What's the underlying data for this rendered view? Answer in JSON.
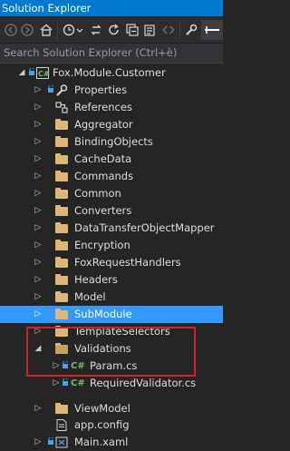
{
  "window": {
    "title": "Solution Explorer"
  },
  "search": {
    "placeholder": "Search Solution Explorer (Ctrl+è)"
  },
  "toolbar": {
    "buttons": [
      "back-icon",
      "forward-icon",
      "home-icon",
      "history-icon",
      "sync-icon",
      "refresh-icon",
      "collapse-icon",
      "properties-wrench-icon",
      "pin-icon"
    ]
  },
  "tree": {
    "project": "Fox.Module.Customer",
    "items": [
      "Properties",
      "References",
      "Aggregator",
      "BindingObjects",
      "CacheData",
      "Commands",
      "Common",
      "Converters",
      "DataTransferObjectMapper",
      "Encryption",
      "FoxRequestHandlers",
      "Headers",
      "Model",
      "SubModule",
      "TemplateSelectors",
      "Validations",
      "Param.cs",
      "RequiredValidator.cs",
      "ViewModel",
      "app.config",
      "Main.xaml"
    ]
  },
  "colors": {
    "titlebar": "#007acc",
    "selection": "#3399ff",
    "highlight": "#d1202d",
    "folder": "#dcb67a"
  }
}
